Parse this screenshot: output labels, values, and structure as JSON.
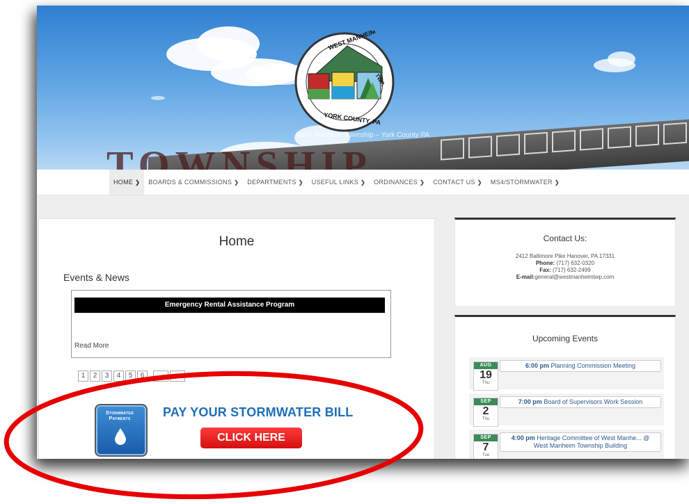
{
  "header": {
    "tagline": "West Manheim Township – York County PA",
    "big_word": "TOWNSHIP",
    "logo_top_text": "WEST MANHEIM",
    "logo_right_text": "TWP.",
    "logo_bottom_text": "YORK COUNTY, PA"
  },
  "nav": {
    "items": [
      {
        "label": "HOME"
      },
      {
        "label": "BOARDS & COMMISSIONS"
      },
      {
        "label": "DEPARTMENTS"
      },
      {
        "label": "USEFUL LINKS"
      },
      {
        "label": "ORDINANCES"
      },
      {
        "label": "CONTACT US"
      },
      {
        "label": "MS4/STORMWATER"
      }
    ]
  },
  "main": {
    "title": "Home",
    "events_heading": "Events & News",
    "news_item_title": "Emergency Rental Assistance Program",
    "read_more": "Read More",
    "pages": [
      "1",
      "2",
      "3",
      "4",
      "5",
      "6"
    ],
    "stormwater_icon_line1": "Stormwater",
    "stormwater_icon_line2": "Payments",
    "pay_text": "PAY YOUR STORMWATER BILL",
    "click_here": "CLICK HERE"
  },
  "contact": {
    "title": "Contact Us:",
    "address": "2412 Baltimore Pike Hanover, PA 17331",
    "phone_label": "Phone:",
    "phone": "(717) 632-0320",
    "fax_label": "Fax:",
    "fax": "(717) 632-2499",
    "email_label": "E-mail:",
    "email": "general@westmanheimtwp.com"
  },
  "events": {
    "title": "Upcoming Events",
    "items": [
      {
        "month": "AUG",
        "day": "19",
        "dow": "Thu",
        "time": "6:00 pm",
        "name": "Planning Commission Meeting",
        "location": ""
      },
      {
        "month": "SEP",
        "day": "2",
        "dow": "Thu",
        "time": "7:00 pm",
        "name": "Board of Supervisors Work Session",
        "location": ""
      },
      {
        "month": "SEP",
        "day": "7",
        "dow": "Tue",
        "time": "4:00 pm",
        "name": "Heritage Committee of West Manhe... @",
        "location": "West Manheim Township Building"
      }
    ]
  },
  "colors": {
    "accent_red": "#e60000",
    "calendar_green": "#3c8b58",
    "link_blue": "#1f6fb6"
  }
}
